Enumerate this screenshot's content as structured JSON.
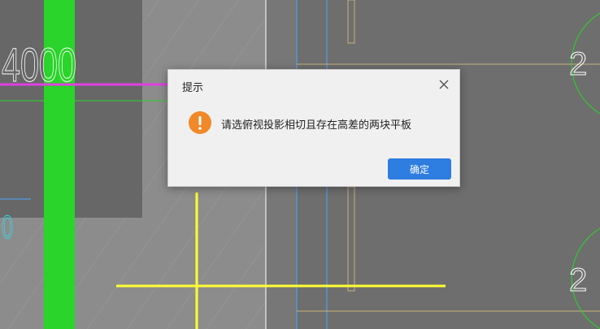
{
  "canvas": {
    "dimension_text": "4000",
    "right_circle_labels": [
      "2",
      "2"
    ],
    "left_cyan_mark": "0"
  },
  "dialog": {
    "title": "提示",
    "close_icon": "close-icon",
    "warning_icon": "exclamation-circle-icon",
    "message": "请选俯视投影相切且存在高差的两块平板",
    "ok_label": "确定"
  },
  "colors": {
    "background": "#6e6e6e",
    "green_column": "#2ad42a",
    "magenta_line": "#e040e0",
    "yellow_line": "#ffff33",
    "cyan_line": "#4aa8ff",
    "tan_line": "#c8b07a",
    "circle_green": "#22dd22",
    "dialog_bg": "#f0f0f0",
    "ok_button": "#2e7de1",
    "warning": "#f0892a"
  }
}
